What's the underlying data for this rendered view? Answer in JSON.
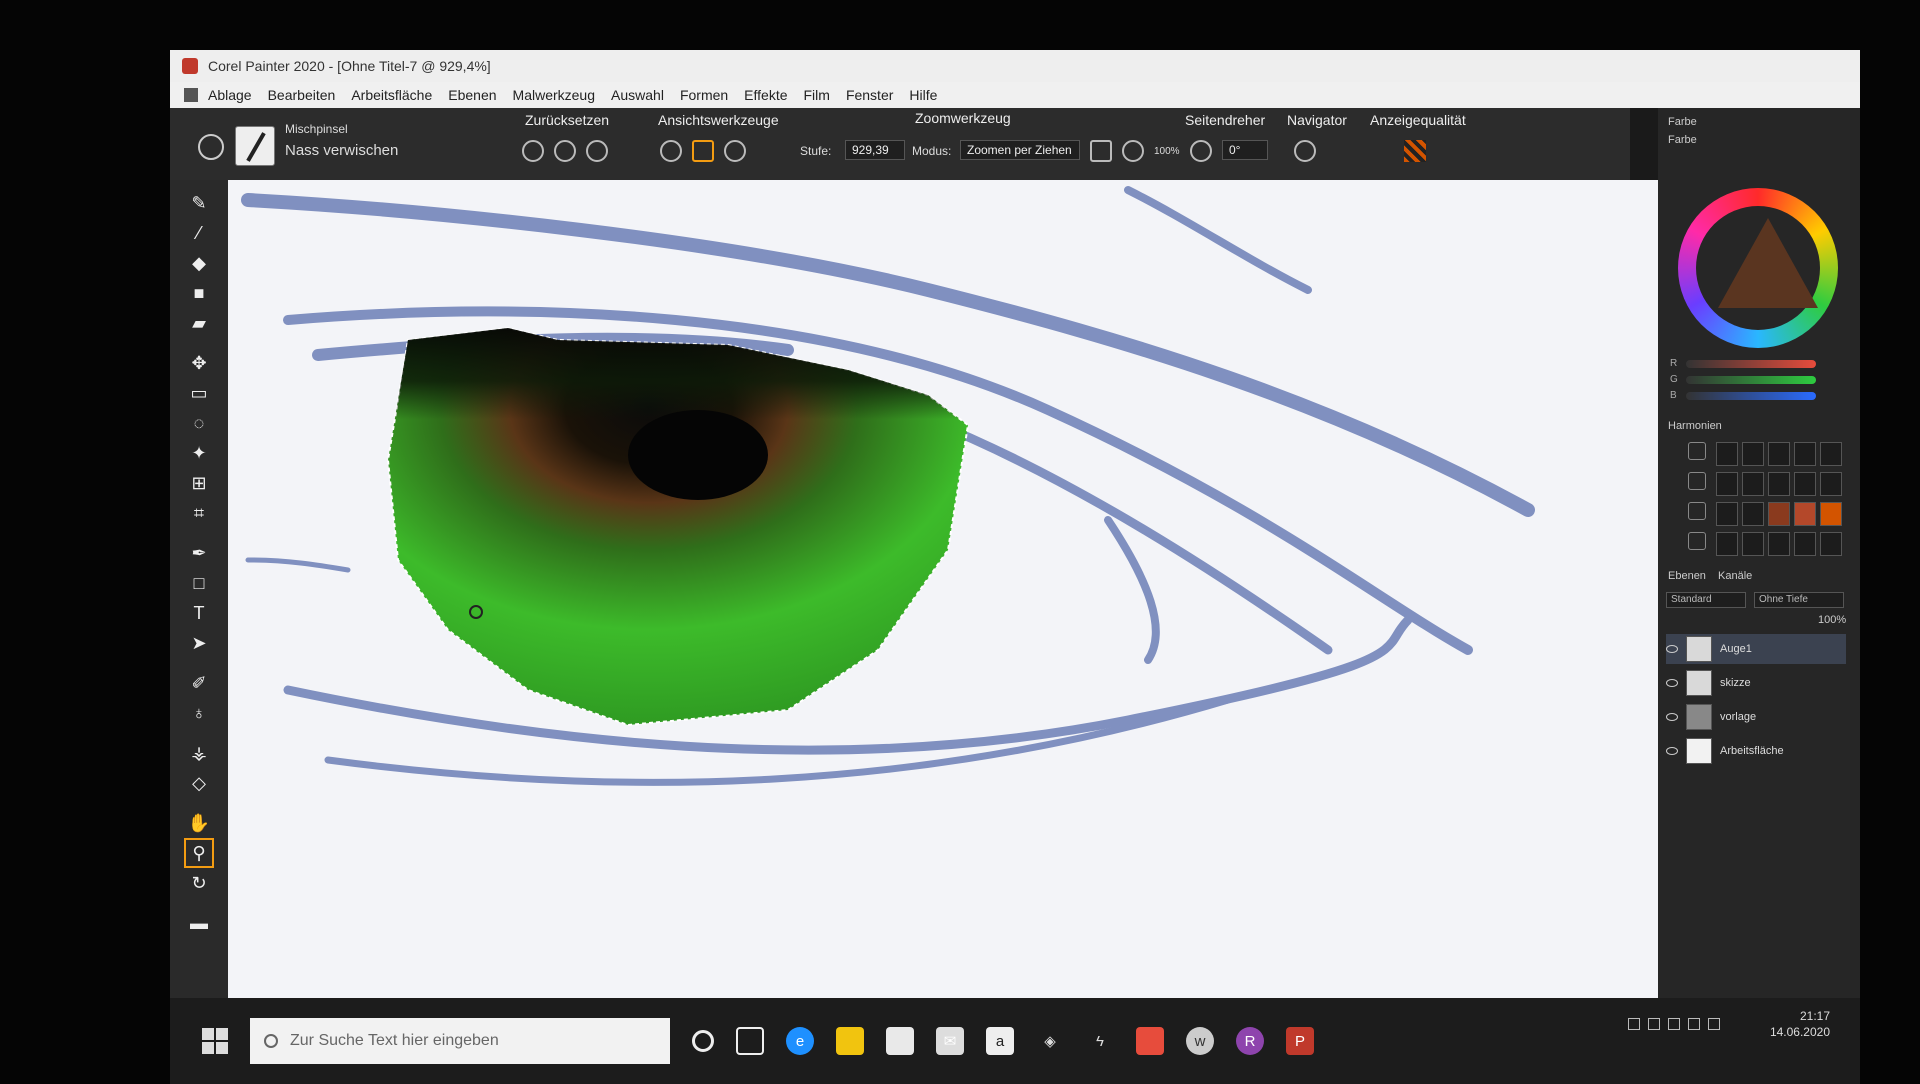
{
  "window": {
    "title": "Corel Painter 2020 - [Ohne Titel-7 @ 929,4%]"
  },
  "menu": [
    "Ablage",
    "Bearbeiten",
    "Arbeitsfläche",
    "Ebenen",
    "Malwerkzeug",
    "Auswahl",
    "Formen",
    "Effekte",
    "Film",
    "Fenster",
    "Hilfe"
  ],
  "propbar": {
    "brush_category": "Mischpinsel",
    "brush_variant": "Nass verwischen",
    "reset_label": "Zurücksetzen",
    "view_tools_label": "Ansichtswerkzeuge",
    "zoom_tool_label": "Zoomwerkzeug",
    "level_label": "Stufe:",
    "level_value": "929,39",
    "mode_label": "Modus:",
    "mode_value": "Zoomen per Ziehen",
    "zoom_100": "100%",
    "rotate_label": "Seitendreher",
    "rotate_value": "0°",
    "navigator_label": "Navigator",
    "quality_label": "Anzeigequalität"
  },
  "color_panel": {
    "tab_color_set": "Farbe",
    "tab_color": "Farbe",
    "r": "R",
    "g": "G",
    "b": "B"
  },
  "harmonies": {
    "title": "Harmonien"
  },
  "layers_panel": {
    "title": "Ebenen",
    "tab_channels": "Kanäle",
    "blend_mode": "Standard",
    "depth": "Ohne Tiefe",
    "opacity": "100%",
    "layers": [
      "Auge1",
      "skizze",
      "vorlage",
      "Arbeitsfläche"
    ]
  },
  "taskbar": {
    "search_placeholder": "Zur Suche Text hier eingeben",
    "time": "21:17",
    "date": "14.06.2020"
  },
  "colors": {
    "accent": "#f39c12",
    "iris_green": "#3dbb2a",
    "sketch_blue": "#5a6fae"
  }
}
